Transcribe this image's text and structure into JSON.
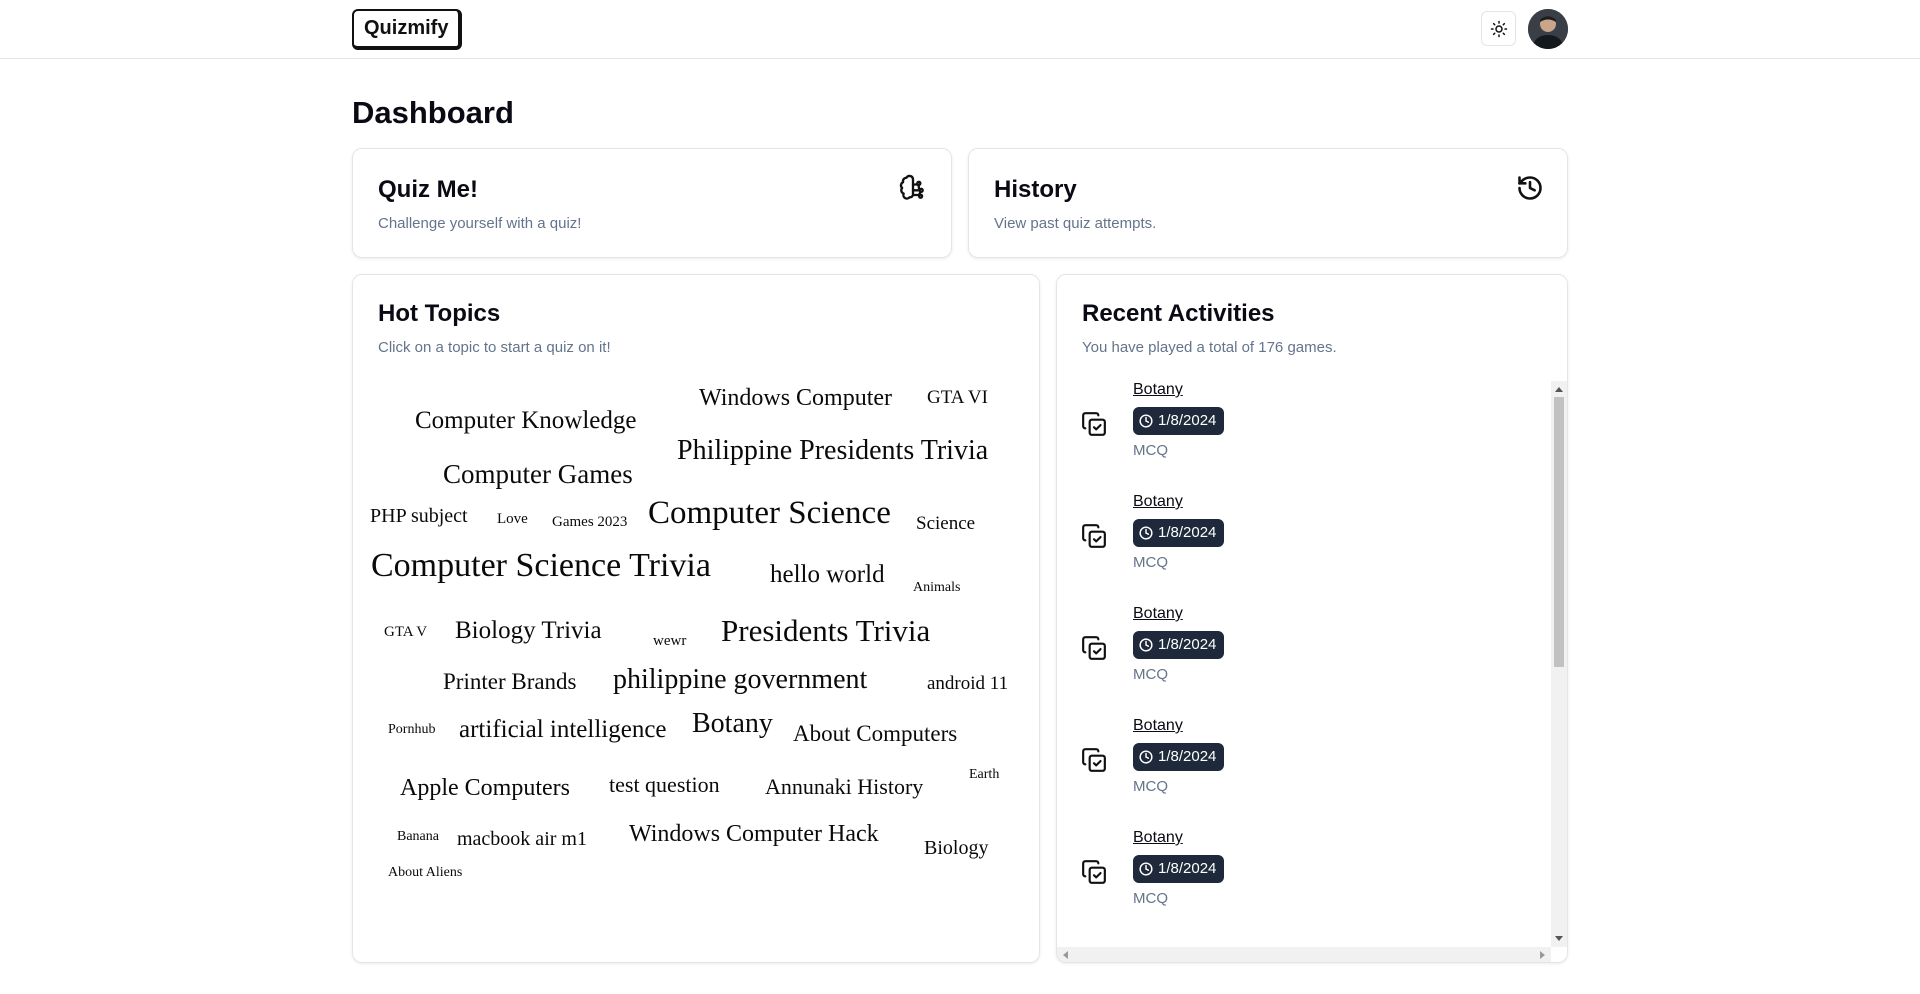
{
  "header": {
    "logo": "Quizmify",
    "theme_toggle_icon": "sun-icon",
    "avatar_icon": "user-avatar"
  },
  "page_title": "Dashboard",
  "quiz_card": {
    "title": "Quiz Me!",
    "description": "Challenge yourself with a quiz!",
    "icon": "brain-circuit-icon"
  },
  "history_card": {
    "title": "History",
    "description": "View past quiz attempts.",
    "icon": "history-icon"
  },
  "hot_topics": {
    "title": "Hot Topics",
    "description": "Click on a topic to start a quiz on it!",
    "topics": [
      "Windows Computer",
      "GTA VI",
      "Computer Knowledge",
      "Philippine Presidents Trivia",
      "Computer Games",
      "PHP subject",
      "Love",
      "Games 2023",
      "Computer Science",
      "Science",
      "Computer Science Trivia",
      "hello world",
      "Animals",
      "GTA V",
      "Biology Trivia",
      "wewr",
      "Presidents Trivia",
      "Printer Brands",
      "philippine government",
      "android 11",
      "Pornhub",
      "artificial intelligence",
      "Botany",
      "About Computers",
      "Apple Computers",
      "test question",
      "Annunaki History",
      "Earth",
      "Banana",
      "macbook air m1",
      "Windows Computer Hack",
      "Biology",
      "About Aliens"
    ]
  },
  "recent_activities": {
    "title": "Recent Activities",
    "description": "You have played a total of 176 games.",
    "items": [
      {
        "topic": "Botany",
        "date": "1/8/2024",
        "type": "MCQ"
      },
      {
        "topic": "Botany",
        "date": "1/8/2024",
        "type": "MCQ"
      },
      {
        "topic": "Botany",
        "date": "1/8/2024",
        "type": "MCQ"
      },
      {
        "topic": "Botany",
        "date": "1/8/2024",
        "type": "MCQ"
      },
      {
        "topic": "Botany",
        "date": "1/8/2024",
        "type": "MCQ"
      }
    ],
    "item_icon": "copy-check-icon",
    "badge_icon": "clock-icon"
  }
}
